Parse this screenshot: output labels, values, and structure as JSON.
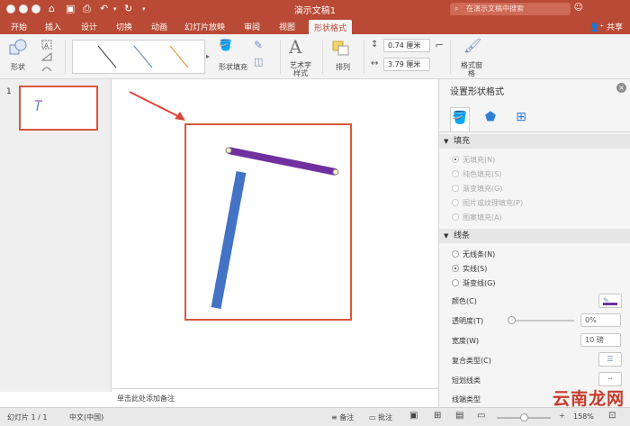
{
  "window": {
    "title": "演示文稿1"
  },
  "search": {
    "placeholder": "在演示文稿中搜索"
  },
  "share_label": "共享",
  "tabs": [
    {
      "label": "开始"
    },
    {
      "label": "插入"
    },
    {
      "label": "设计"
    },
    {
      "label": "切换"
    },
    {
      "label": "动画"
    },
    {
      "label": "幻灯片放映"
    },
    {
      "label": "审阅"
    },
    {
      "label": "视图"
    },
    {
      "label": "形状格式"
    }
  ],
  "ribbon": {
    "shape_label": "形状",
    "shape_fill_label": "形状填充",
    "wordart_label": "艺术字样式",
    "arrange_label": "排列",
    "height_value": "0.74 厘米",
    "width_value": "3.79 厘米",
    "format_pane_label": "格式窗格"
  },
  "thumbs": {
    "slide_number": "1"
  },
  "notes_placeholder": "单击此处添加备注",
  "pane": {
    "title": "设置形状格式",
    "fill_section": "填充",
    "fill_options": [
      "无填充(N)",
      "纯色填充(S)",
      "渐变填充(G)",
      "图片或纹理填充(P)",
      "图案填充(A)"
    ],
    "line_section": "线条",
    "line_options": [
      "无线条(N)",
      "实线(S)",
      "渐变线(G)"
    ],
    "color_label": "颜色(C)",
    "transparency_label": "透明度(T)",
    "transparency_value": "0%",
    "width_label": "宽度(W)",
    "width_value": "10 磅",
    "compound_label": "复合类型(C)",
    "dash_label": "短划线类",
    "cap_label": "线端类型"
  },
  "status": {
    "slide_info": "幻灯片 1 / 1",
    "language": "中文(中国)",
    "notes_label": "备注",
    "comments_label": "批注",
    "zoom": "158%"
  },
  "watermark_text": "云南龙网",
  "colors": {
    "brand": "#b94a35",
    "accent": "#d8573d",
    "line_blue": "#4472c4",
    "line_purple": "#7030a0"
  }
}
